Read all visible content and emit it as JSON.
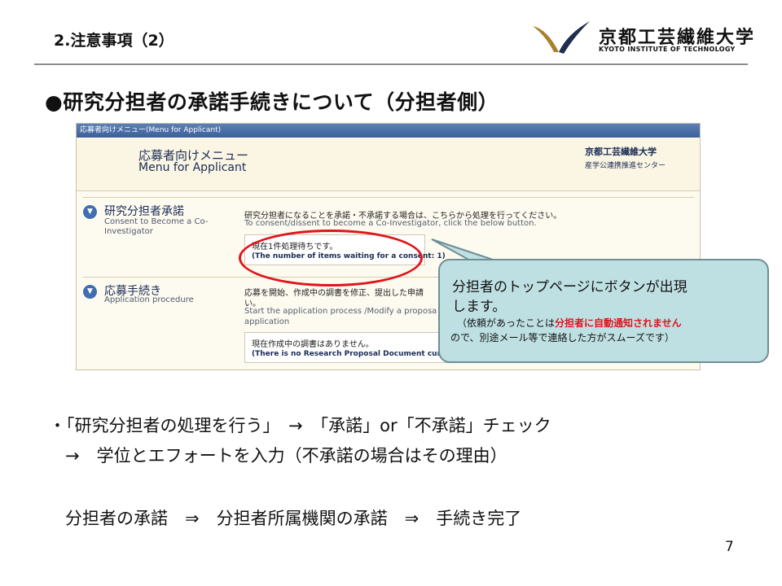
{
  "header": {
    "section_title": "2.注意事項（2）",
    "logo_jp": "京都工芸繊維大学",
    "logo_en": "KYOTO INSTITUTE OF TECHNOLOGY"
  },
  "main_heading": "●研究分担者の承諾手続きについて（分担者側）",
  "screenshot": {
    "title_bar": "応募者向けメニュー(Menu for Applicant)",
    "menu_jp": "応募者向けメニュー",
    "menu_en": "Menu for Applicant",
    "institution": "京都工芸繊維大学",
    "center": "産学公連携推進センター",
    "items": [
      {
        "label_jp": "研究分担者承諾",
        "label_en": "Consent to Become a Co-Investigator",
        "desc_jp": "研究分担者になることを承諾・不承諾する場合は、こちらから処理を行ってください。",
        "desc_en": "To consent/dissent to become a Co-Investigator, click the below button.",
        "status_jp": "現在1件処理待ちです。",
        "status_en": "(The number of items waiting for a consent: 1)"
      },
      {
        "label_jp": "応募手続き",
        "label_en": "Application procedure",
        "desc_jp": "応募を開始、作成中の調書を修正、提出した申請",
        "desc_jp2": "い。",
        "desc_en": "Start the application process /Modify a proposa",
        "desc_en2": "application",
        "status_jp": "現在作成中の調書はありません。",
        "status_en": "(There is no Research Proposal Document currently"
      }
    ]
  },
  "callout": {
    "line1": "分担者のトップページにボタンが出現",
    "line2": "します。",
    "line3_pre": "（依頼があったことは",
    "line3_red": "分担者に自動通知されません",
    "line4": "ので、別途メール等で連絡した方がスムーズです）"
  },
  "body": {
    "line1": "・「研究分担者の処理を行う」　→　「承諾」or「不承諾」チェック",
    "line2": "→　学位とエフォートを入力（不承諾の場合はその理由）",
    "line3": "分担者の承諾　⇒　分担者所属機関の承諾　⇒　手続き完了"
  },
  "page_number": "7",
  "colors": {
    "accent_red": "#e0141b",
    "callout_bg": "#bfe0e3",
    "titlebar_blue": "#3c5f98",
    "logo_gold": "#a8802a",
    "logo_navy": "#1f2d4f"
  }
}
